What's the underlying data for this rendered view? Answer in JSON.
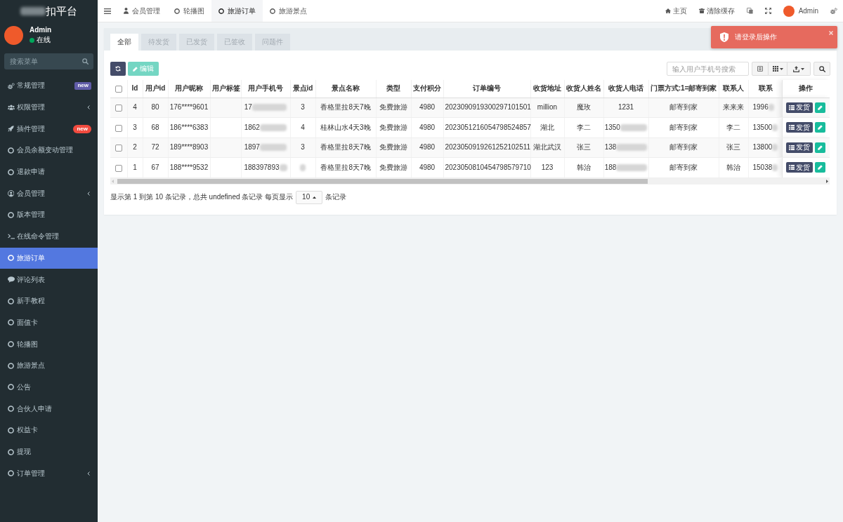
{
  "sidebar": {
    "logo": {
      "text": "扣平台",
      "blurred": true
    },
    "user": {
      "name": "Admin",
      "status": "在线"
    },
    "search": {
      "placeholder": "搜索菜单"
    },
    "items": [
      {
        "label": "常规管理",
        "selected": false,
        "badge": {
          "text": "new",
          "kind": "label",
          "color": "#605ca8"
        }
      },
      {
        "label": "权限管理",
        "selected": false,
        "expanded": false
      },
      {
        "label": "插件管理",
        "selected": false,
        "badge": {
          "text": "new",
          "kind": "pill",
          "color": "#f24b3f"
        }
      },
      {
        "label": "会员余额变动管理",
        "selected": false
      },
      {
        "label": "退款申请",
        "selected": false
      },
      {
        "label": "会员管理",
        "selected": false,
        "expanded": false
      },
      {
        "label": "版本管理",
        "selected": false
      },
      {
        "label": "在线命令管理",
        "selected": false
      },
      {
        "label": "旅游订单",
        "selected": true
      },
      {
        "label": "评论列表",
        "selected": false
      },
      {
        "label": "新手教程",
        "selected": false
      },
      {
        "label": "面值卡",
        "selected": false
      },
      {
        "label": "轮播图",
        "selected": false
      },
      {
        "label": "旅游景点",
        "selected": false
      },
      {
        "label": "公告",
        "selected": false
      },
      {
        "label": "合伙人申请",
        "selected": false
      },
      {
        "label": "权益卡",
        "selected": false
      },
      {
        "label": "提现",
        "selected": false
      },
      {
        "label": "订单管理",
        "selected": false,
        "expanded": false
      }
    ]
  },
  "topbar": {
    "tabs": [
      {
        "label": "会员管理",
        "selected": false
      },
      {
        "label": "轮播图",
        "selected": false
      },
      {
        "label": "旅游订单",
        "selected": true
      },
      {
        "label": "旅游景点",
        "selected": false
      }
    ],
    "links": [
      {
        "label": "主页"
      },
      {
        "label": "清除缓存"
      }
    ],
    "user": {
      "name": "Admin"
    }
  },
  "toast": {
    "message": "请登录后操作"
  },
  "panel": {
    "tabs": [
      {
        "label": "全部",
        "selected": true
      },
      {
        "label": "待发货",
        "selected": false
      },
      {
        "label": "已发货",
        "selected": false
      },
      {
        "label": "已签收",
        "selected": false
      },
      {
        "label": "问题件",
        "selected": false
      }
    ],
    "toolbar": {
      "edit_button": {
        "label": "编辑",
        "disabled": true
      },
      "search": {
        "placeholder": "输入用户手机号搜索"
      }
    },
    "table": {
      "select_all": {
        "checked": false
      },
      "columns": [
        "Id",
        "用户id",
        "用户昵称",
        "用户标签",
        "用户手机号",
        "景点id",
        "景点名称",
        "类型",
        "支付积分",
        "订单编号",
        "收货地址",
        "收货人姓名",
        "收货人电话",
        "门票方式:1=邮寄到家",
        "联系人",
        "联系"
      ],
      "action_column": "操作",
      "rows": [
        {
          "checked": false,
          "ship_label": "发货",
          "cells": [
            "4",
            "80",
            "176****9601",
            null,
            {
              "text": "17",
              "blurred": true
            },
            "3",
            "香格里拉8天7晚",
            "免费旅游",
            "4980",
            "2023090919300297101501",
            "million",
            "魔玫",
            "1231",
            "邮寄到家",
            "来来来",
            {
              "text": "1996",
              "blurred": true
            }
          ]
        },
        {
          "checked": false,
          "ship_label": "发货",
          "cells": [
            "3",
            "68",
            "186****6383",
            null,
            {
              "text": "1862",
              "blurred": true
            },
            "4",
            "桂林山水4天3晚",
            "免费旅游",
            "4980",
            "2023051216054798524857",
            "湖北",
            "李二",
            {
              "text": "1350",
              "blurred": true
            },
            "邮寄到家",
            "李二",
            {
              "text": "13500",
              "blurred": true
            }
          ]
        },
        {
          "checked": false,
          "ship_label": "发货",
          "cells": [
            "2",
            "72",
            "189****8903",
            null,
            {
              "text": "1897",
              "blurred": true
            },
            "3",
            "香格里拉8天7晚",
            "免费旅游",
            "4980",
            "2023050919261252102511",
            "湖北武汉",
            "张三",
            {
              "text": "138",
              "blurred": true
            },
            "邮寄到家",
            "张三",
            {
              "text": "13800",
              "blurred": true
            }
          ]
        },
        {
          "checked": false,
          "ship_label": "发货",
          "cells": [
            "1",
            "67",
            "188****9532",
            null,
            {
              "text": "188397893",
              "blurred": true
            },
            {
              "blurred": true
            },
            "香格里拉8天7晚",
            "免费旅游",
            "4980",
            "2023050810454798579710",
            "123",
            "韩治",
            {
              "text": "188",
              "blurred": true
            },
            "邮寄到家",
            "韩治",
            {
              "text": "15038",
              "blurred": true
            }
          ]
        }
      ]
    },
    "pagination": {
      "summary": "显示第 1 到第 10 条记录，总共 undefined 条记录 每页显示",
      "page_size": "10",
      "suffix": "条记录"
    }
  }
}
